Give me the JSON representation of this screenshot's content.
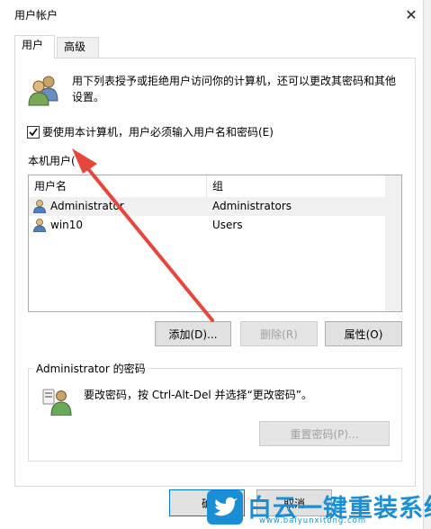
{
  "window": {
    "title": "用户帐户",
    "close_glyph": "✕"
  },
  "tabs": [
    {
      "label": "用户",
      "active": true
    },
    {
      "label": "高级",
      "active": false
    }
  ],
  "intro": {
    "text": "用下列表授予或拒绝用户访问你的计算机，还可以更改其密码和其他设置。"
  },
  "require_login": {
    "label": "要使用本计算机，用户必须输入用户名和密码(E)",
    "checked": true
  },
  "local_users": {
    "label": "本机用户(",
    "columns": [
      "用户名",
      "组"
    ],
    "rows": [
      {
        "name": "Administrator",
        "group": "Administrators",
        "selected": true
      },
      {
        "name": "win10",
        "group": "Users",
        "selected": false
      }
    ]
  },
  "buttons": {
    "add": "添加(D)...",
    "remove": "删除(R)",
    "properties": "属性(O)",
    "ok": "确",
    "cancel": "取消"
  },
  "password_group": {
    "title": "Administrator 的密码",
    "text": "要改密码，按 Ctrl-Alt-Del 并选择“更改密码”。",
    "reset_button": "重置密码(P)..."
  },
  "watermark": {
    "title": "白云一键重装系统",
    "url": "www.baiyunxitong.com"
  },
  "colors": {
    "accent": "#0078d7",
    "arrow": "#e8453c",
    "watermark": "#1a8fd6"
  },
  "icons": [
    "users-icon",
    "user-icon",
    "user-key-icon",
    "close-icon",
    "checkmark-icon",
    "twitter-bird-icon"
  ]
}
